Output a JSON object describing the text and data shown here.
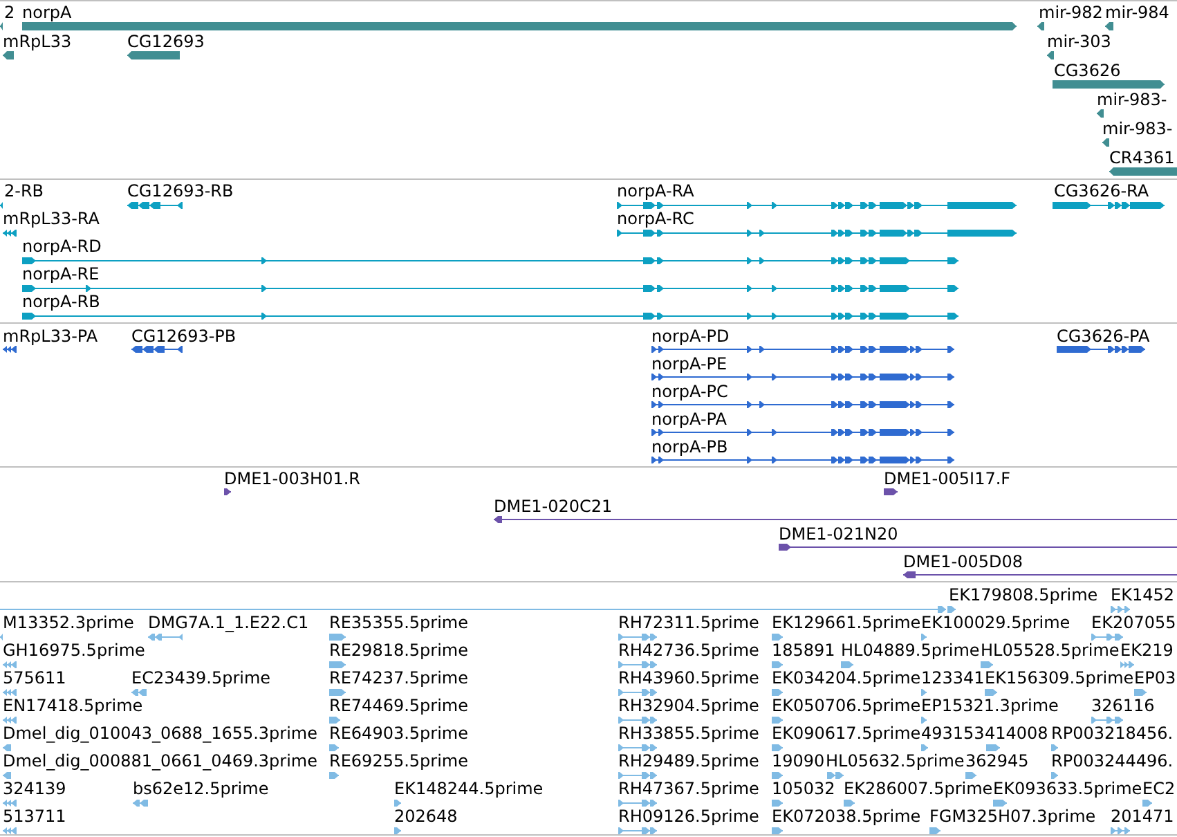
{
  "tracks": [
    {
      "kind": "gene",
      "features": [
        {
          "label": "2",
          "forward": false
        },
        {
          "label": "norpA",
          "forward": true
        },
        {
          "label": "mir-982",
          "forward": false
        },
        {
          "label": "mir-984",
          "forward": false
        },
        {
          "label": "mRpL33",
          "forward": false
        },
        {
          "label": "CG12693",
          "forward": false
        },
        {
          "label": "mir-303",
          "forward": false
        },
        {
          "label": "CG3626",
          "forward": true
        },
        {
          "label": "mir-983-",
          "forward": false
        },
        {
          "label": "mir-983-",
          "forward": false
        },
        {
          "label": "CR4361",
          "forward": false
        }
      ]
    },
    {
      "kind": "transcript",
      "features": [
        {
          "label": "2-RB",
          "forward": false
        },
        {
          "label": "CG12693-RB",
          "forward": false
        },
        {
          "label": "norpA-RA",
          "forward": true
        },
        {
          "label": "CG3626-RA",
          "forward": true
        },
        {
          "label": "mRpL33-RA",
          "forward": false
        },
        {
          "label": "norpA-RC",
          "forward": true
        },
        {
          "label": "norpA-RD",
          "forward": true
        },
        {
          "label": "norpA-RE",
          "forward": true
        },
        {
          "label": "norpA-RB",
          "forward": true
        }
      ]
    },
    {
      "kind": "protein",
      "features": [
        {
          "label": "mRpL33-PA",
          "forward": false
        },
        {
          "label": "CG12693-PB",
          "forward": false
        },
        {
          "label": "norpA-PD",
          "forward": true
        },
        {
          "label": "CG3626-PA",
          "forward": true
        },
        {
          "label": "norpA-PE",
          "forward": true
        },
        {
          "label": "norpA-PC",
          "forward": true
        },
        {
          "label": "norpA-PA",
          "forward": true
        },
        {
          "label": "norpA-PB",
          "forward": true
        }
      ]
    },
    {
      "kind": "clone",
      "features": [
        {
          "label": "DME1-003H01.R",
          "forward": true
        },
        {
          "label": "DME1-005I17.F",
          "forward": true
        },
        {
          "label": "DME1-020C21",
          "forward": false
        },
        {
          "label": "DME1-021N20",
          "forward": true
        },
        {
          "label": "DME1-005D08",
          "forward": false
        }
      ]
    },
    {
      "kind": "est",
      "features": [
        {
          "forward": true
        },
        {
          "label": "EK179808.5prime",
          "forward": true
        },
        {
          "label": "EK1452",
          "forward": true
        },
        {
          "label": "M13352.3prime",
          "forward": false
        },
        {
          "label": "DMG7A.1_1.E22.C1",
          "forward": false
        },
        {
          "label": "RE35355.5prime",
          "forward": true
        },
        {
          "label": "RH72311.5prime",
          "forward": true
        },
        {
          "label": "EK129661.5prime",
          "forward": true
        },
        {
          "label": "EK100029.5prime",
          "forward": true
        },
        {
          "label": "EK207055",
          "forward": true
        },
        {
          "label": "GH16975.5prime",
          "forward": false
        },
        {
          "label": "RE29818.5prime",
          "forward": true
        },
        {
          "label": "RH42736.5prime",
          "forward": true
        },
        {
          "label": "185891",
          "forward": true
        },
        {
          "label": "HL04889.5prime",
          "forward": true
        },
        {
          "label": "HL05528.5prime",
          "forward": true
        },
        {
          "label": "EK219",
          "forward": true
        },
        {
          "label": "575611",
          "forward": false
        },
        {
          "label": "EC23439.5prime",
          "forward": false
        },
        {
          "label": "RE74237.5prime",
          "forward": true
        },
        {
          "label": "RH43960.5prime",
          "forward": true
        },
        {
          "label": "EK034204.5prime",
          "forward": true
        },
        {
          "label": "123341",
          "forward": true
        },
        {
          "label": "EK156309.5prime",
          "forward": true
        },
        {
          "label": "EP03",
          "forward": true
        },
        {
          "label": "EN17418.5prime",
          "forward": false
        },
        {
          "label": "RE74469.5prime",
          "forward": true
        },
        {
          "label": "RH32904.5prime",
          "forward": true
        },
        {
          "label": "EK050706.5prime",
          "forward": true
        },
        {
          "label": "EP15321.3prime",
          "forward": true
        },
        {
          "label": "326116",
          "forward": true
        },
        {
          "label": "Dmel_dig_010043_0688_1655.3prime",
          "forward": false
        },
        {
          "label": "RE64903.5prime",
          "forward": true
        },
        {
          "label": "RH33855.5prime",
          "forward": true
        },
        {
          "label": "EK090617.5prime",
          "forward": true
        },
        {
          "label": "493153",
          "forward": true
        },
        {
          "label": "414008",
          "forward": true
        },
        {
          "label": "RP003218456.",
          "forward": true
        },
        {
          "label": "Dmel_dig_000881_0661_0469.3prime",
          "forward": false
        },
        {
          "label": "RE69255.5prime",
          "forward": true
        },
        {
          "label": "RH29489.5prime",
          "forward": true
        },
        {
          "label": "19090",
          "forward": true
        },
        {
          "label": "HL05632.5prime",
          "forward": true
        },
        {
          "label": "362945",
          "forward": true
        },
        {
          "label": "RP003244496.",
          "forward": true
        },
        {
          "label": "324139",
          "forward": false
        },
        {
          "label": "bs62e12.5prime",
          "forward": false
        },
        {
          "label": "EK148244.5prime",
          "forward": true
        },
        {
          "label": "RH47367.5prime",
          "forward": true
        },
        {
          "label": "105032",
          "forward": true
        },
        {
          "label": "EK286007.5prime",
          "forward": true
        },
        {
          "label": "EK093633.5prime",
          "forward": true
        },
        {
          "label": "EC2",
          "forward": true
        },
        {
          "label": "513711",
          "forward": false
        },
        {
          "label": "202648",
          "forward": true
        },
        {
          "label": "RH09126.5prime",
          "forward": true
        },
        {
          "label": "EK072038.5prime",
          "forward": true
        },
        {
          "label": "FGM325H07.3prime",
          "forward": true
        },
        {
          "label": "201471",
          "forward": true
        }
      ]
    }
  ]
}
